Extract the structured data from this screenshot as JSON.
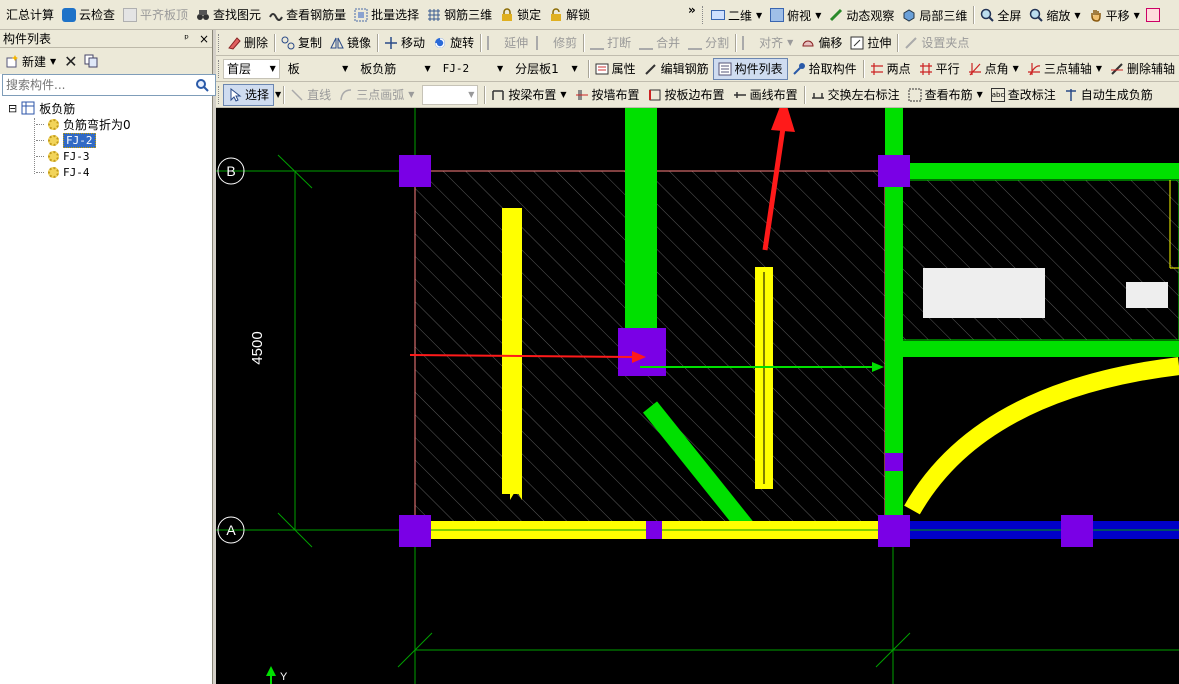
{
  "toolbar1": {
    "items": [
      {
        "label": "汇总计算"
      },
      {
        "label": "云检查"
      },
      {
        "label": "平齐板顶",
        "disabled": true
      },
      {
        "label": "查找图元"
      },
      {
        "label": "查看钢筋量"
      },
      {
        "label": "批量选择"
      },
      {
        "label": "钢筋三维"
      },
      {
        "label": "锁定"
      },
      {
        "label": "解锁"
      }
    ],
    "overflow": "»",
    "right_items": [
      {
        "label": "二维"
      },
      {
        "label": "俯视"
      },
      {
        "label": "动态观察"
      },
      {
        "label": "局部三维"
      },
      {
        "label": "全屏"
      },
      {
        "label": "缩放"
      },
      {
        "label": "平移"
      }
    ]
  },
  "panel": {
    "title": "构件列表",
    "pin": "ᵖ",
    "close": "×",
    "new_label": "新建",
    "search_placeholder": "搜索构件...",
    "tree": {
      "root": "板负筋",
      "expander": "⊟",
      "children": [
        "负筋弯折为0",
        "FJ-2",
        "FJ-3",
        "FJ-4"
      ]
    }
  },
  "toolbar2": {
    "items": [
      {
        "label": "删除"
      },
      {
        "label": "复制"
      },
      {
        "label": "镜像"
      },
      {
        "label": "移动"
      },
      {
        "label": "旋转"
      },
      {
        "label": "延伸",
        "disabled": true
      },
      {
        "label": "修剪",
        "disabled": true
      },
      {
        "label": "打断",
        "disabled": true
      },
      {
        "label": "合并",
        "disabled": true
      },
      {
        "label": "分割",
        "disabled": true
      },
      {
        "label": "对齐",
        "disabled": true
      },
      {
        "label": "偏移"
      },
      {
        "label": "拉伸"
      },
      {
        "label": "设置夹点",
        "disabled": true
      }
    ]
  },
  "toolbar3": {
    "floor": "首层",
    "category": "板",
    "type": "板负筋",
    "component": "FJ-2",
    "layer": "分层板1",
    "items": [
      {
        "label": "属性"
      },
      {
        "label": "编辑钢筋"
      },
      {
        "label": "构件列表",
        "active": true
      },
      {
        "label": "拾取构件"
      },
      {
        "label": "两点"
      },
      {
        "label": "平行"
      },
      {
        "label": "点角"
      },
      {
        "label": "三点辅轴"
      },
      {
        "label": "删除辅轴"
      }
    ]
  },
  "toolbar4": {
    "items": [
      {
        "label": "选择",
        "active": true
      },
      {
        "label": "直线",
        "disabled": true
      },
      {
        "label": "三点画弧",
        "disabled": true
      },
      {
        "label": "按梁布置"
      },
      {
        "label": "按墙布置"
      },
      {
        "label": "按板边布置"
      },
      {
        "label": "画线布置"
      },
      {
        "label": "交换左右标注"
      },
      {
        "label": "查看布筋"
      },
      {
        "label": "查改标注"
      },
      {
        "label": "自动生成负筋"
      }
    ]
  },
  "canvas": {
    "axis_b": "B",
    "axis_a": "A",
    "dim_vertical": "4500",
    "ucs_y": "Y",
    "colors": {
      "grid": "#00a000",
      "column": "#7a00e6",
      "beam_green": "#00e000",
      "rebar_yellow": "#ffff00",
      "arrow_red": "#ff1a1a",
      "slab_border": "#ff8080",
      "beam_blue": "#0000c8"
    }
  }
}
